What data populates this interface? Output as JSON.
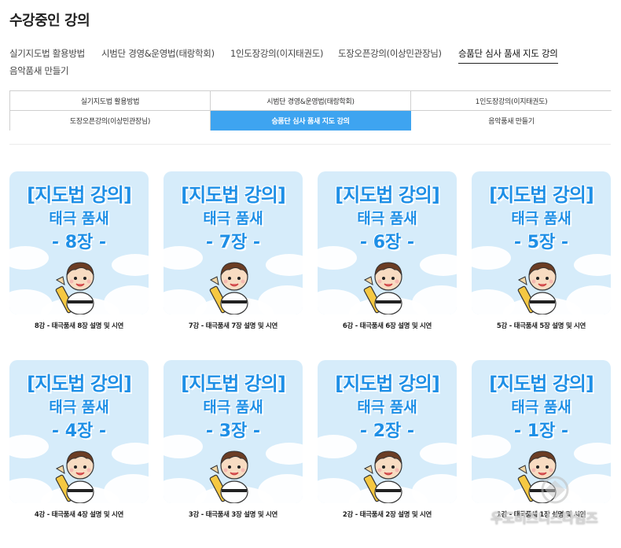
{
  "page": {
    "title": "수강중인 강의"
  },
  "tabs": [
    {
      "label": "실기지도법 활용방법",
      "active": false
    },
    {
      "label": "시범단 경영&운영법(태랑학회)",
      "active": false
    },
    {
      "label": "1인도장강의(이지태권도)",
      "active": false
    },
    {
      "label": "도장오픈강의(이상민관장님)",
      "active": false
    },
    {
      "label": "승품단 심사 품새 지도 강의",
      "active": true
    },
    {
      "label": "음악품새 만들기",
      "active": false
    }
  ],
  "grid_tabs": [
    {
      "label": "실기지도법 활용방법",
      "active": false
    },
    {
      "label": "시범단 경영&운영법(태랑학회)",
      "active": false
    },
    {
      "label": "1인도장강의(이지태권도)",
      "active": false
    },
    {
      "label": "도장오픈강의(이상민관장님)",
      "active": false
    },
    {
      "label": "승품단 심사 품새 지도 강의",
      "active": true
    },
    {
      "label": "음악품새 만들기",
      "active": false
    }
  ],
  "courses": [
    {
      "thumb_title": "[지도법 강의]",
      "thumb_sub": "태극 품새",
      "thumb_chapter": "- 8장 -",
      "caption": "8강 - 태극품새 8장 설명 및 시연"
    },
    {
      "thumb_title": "[지도법 강의]",
      "thumb_sub": "태극 품새",
      "thumb_chapter": "- 7장 -",
      "caption": "7강 - 태극품새 7장 설명 및 시연"
    },
    {
      "thumb_title": "[지도법 강의]",
      "thumb_sub": "태극 품새",
      "thumb_chapter": "- 6장 -",
      "caption": "6강 - 태극품새 6장 설명 및 시연"
    },
    {
      "thumb_title": "[지도법 강의]",
      "thumb_sub": "태극 품새",
      "thumb_chapter": "- 5장 -",
      "caption": "5강 - 태극품새 5장 설명 및 시연"
    },
    {
      "thumb_title": "[지도법 강의]",
      "thumb_sub": "태극 품새",
      "thumb_chapter": "- 4장 -",
      "caption": "4강 - 태극품새 4장 설명 및 시연"
    },
    {
      "thumb_title": "[지도법 강의]",
      "thumb_sub": "태극 품새",
      "thumb_chapter": "- 3장 -",
      "caption": "3강 - 태극품새 3장 설명 및 시연"
    },
    {
      "thumb_title": "[지도법 강의]",
      "thumb_sub": "태극 품새",
      "thumb_chapter": "- 2장 -",
      "caption": "2강 - 태극품새 2장 설명 및 시연"
    },
    {
      "thumb_title": "[지도법 강의]",
      "thumb_sub": "태극 품새",
      "thumb_chapter": "- 1장 -",
      "caption": "1강 - 태극품새 1장 설명 및 시연"
    }
  ],
  "watermark": {
    "text": "우도비즈니스타임즈"
  },
  "colors": {
    "accent": "#3ea4f0",
    "thumb_bg": "#d6ecfa",
    "thumb_text": "#1e8fe6"
  }
}
